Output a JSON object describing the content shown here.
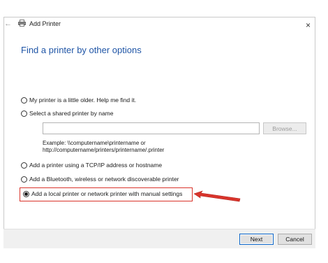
{
  "window": {
    "title": "Add Printer",
    "close_glyph": "×",
    "back_glyph": "←"
  },
  "heading": "Find a printer by other options",
  "options": [
    {
      "label": "My printer is a little older. Help me find it.",
      "selected": false
    },
    {
      "label": "Select a shared printer by name",
      "selected": false
    },
    {
      "label": "Add a printer using a TCP/IP address or hostname",
      "selected": false
    },
    {
      "label": "Add a Bluetooth, wireless or network discoverable printer",
      "selected": false
    },
    {
      "label": "Add a local printer or network printer with manual settings",
      "selected": true
    }
  ],
  "shared_printer": {
    "input_value": "",
    "browse_label": "Browse...",
    "example_line1": "Example: \\\\computername\\printername or",
    "example_line2": "http://computername/printers/printername/.printer"
  },
  "buttons": {
    "next": "Next",
    "cancel": "Cancel"
  },
  "colors": {
    "heading": "#1f55a6",
    "highlight": "#d9342b",
    "next_border": "#0a64c8"
  },
  "icons": {
    "title": "printer-icon",
    "back": "back-arrow-icon",
    "close": "close-icon",
    "annotation": "red-arrow-icon"
  }
}
